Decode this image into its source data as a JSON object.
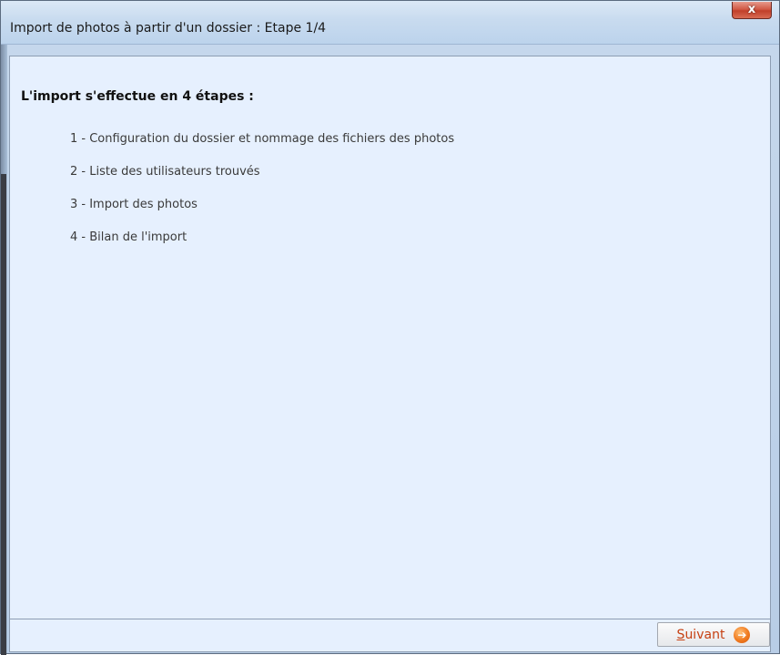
{
  "window": {
    "title": "Import de photos à partir d'un dossier : Etape 1/4",
    "close_label": "x"
  },
  "main": {
    "heading": "L'import s'effectue en 4 étapes :",
    "steps": [
      "1 - Configuration du dossier et nommage des fichiers des photos",
      "2 - Liste des utilisateurs trouvés",
      "3 - Import des photos",
      "4 - Bilan de l'import"
    ]
  },
  "footer": {
    "next_label": "Suivant",
    "next_icon": "arrow-right-circle-icon",
    "next_icon_glyph": "➔"
  },
  "colors": {
    "content_bg": "#e6f0fe",
    "close_button": "#c13f2a",
    "next_text": "#c64012",
    "next_icon": "#f07a1f"
  }
}
